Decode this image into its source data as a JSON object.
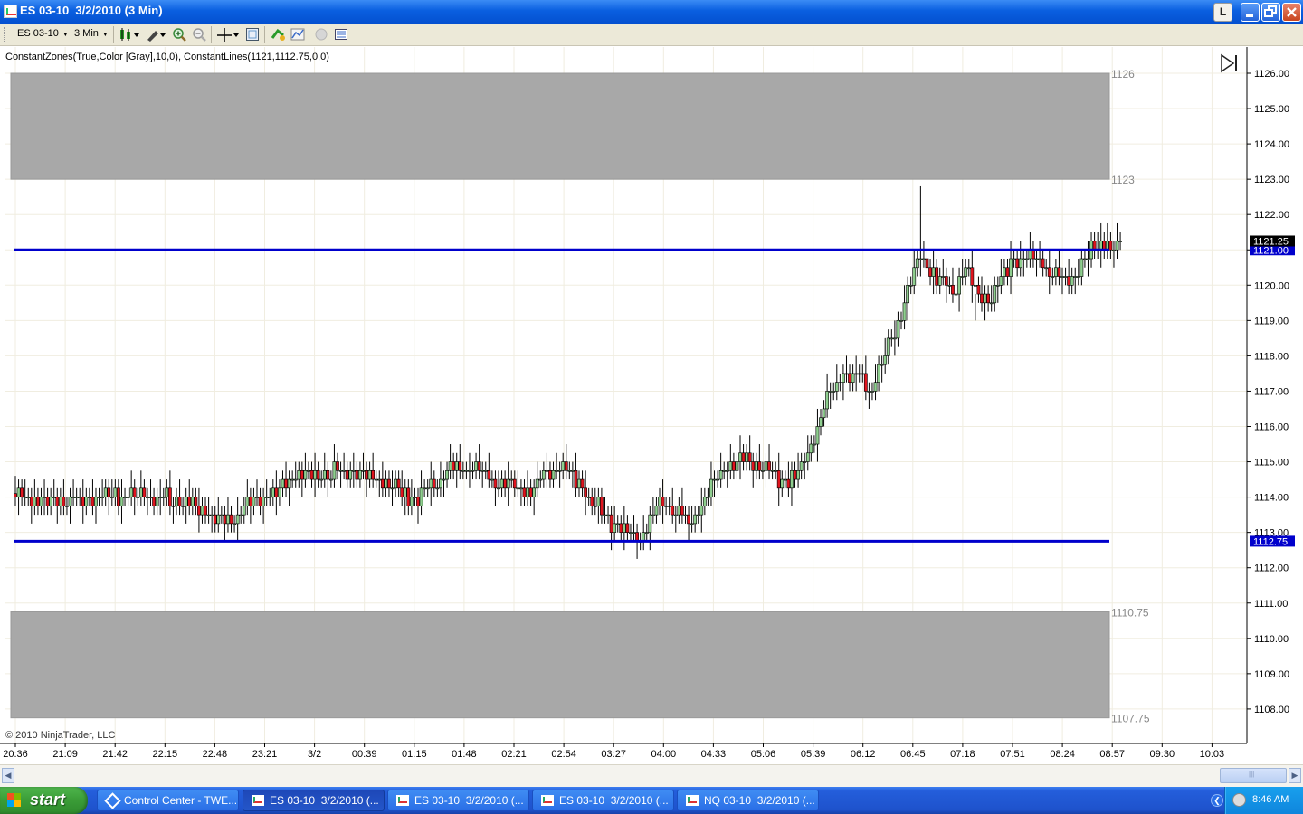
{
  "window": {
    "title": "ES 03-10  3/2/2010 (3 Min)",
    "buttons": {
      "link": "L",
      "minimize": "▁",
      "restore": "❐",
      "close": "✕"
    }
  },
  "toolbar": {
    "instrument": "ES 03-10",
    "interval": "3 Min"
  },
  "indicator_label": "ConstantZones(True,Color [Gray],10,0), ConstantLines(1121,1112.75,0,0)",
  "copyright": "© 2010 NinjaTrader, LLC",
  "colors": {
    "up_bar": "#8fcf8f",
    "down_bar": "#e0141e",
    "zone": "#a8a8a8",
    "line": "#0000cc",
    "grid": "#f0ede0"
  },
  "chart_data": {
    "type": "candlestick",
    "title": "",
    "ylim": [
      1107.4,
      1126.5
    ],
    "y_ticks": [
      "1126.00",
      "1125.00",
      "1124.00",
      "1123.00",
      "1122.00",
      "1121.00",
      "1120.00",
      "1119.00",
      "1118.00",
      "1117.00",
      "1116.00",
      "1115.00",
      "1114.00",
      "1113.00",
      "1112.00",
      "1111.00",
      "1110.00",
      "1109.00",
      "1108.00"
    ],
    "x_ticks": [
      "20:36",
      "21:09",
      "21:42",
      "22:15",
      "22:48",
      "23:21",
      "3/2",
      "00:39",
      "01:15",
      "01:48",
      "02:21",
      "02:54",
      "03:27",
      "04:00",
      "04:33",
      "05:06",
      "05:39",
      "06:12",
      "06:45",
      "07:18",
      "07:51",
      "08:24",
      "08:57",
      "09:30",
      "10:03"
    ],
    "zones": [
      {
        "top": 1126,
        "bottom": 1123,
        "top_label": "1126",
        "bottom_label": "1123"
      },
      {
        "top": 1110.75,
        "bottom": 1107.75,
        "top_label": "1110.75",
        "bottom_label": "1107.75"
      }
    ],
    "lines": [
      {
        "value": 1121,
        "label": "1121.00"
      },
      {
        "value": 1112.75,
        "label": "1112.75"
      }
    ],
    "last_price": {
      "value": 1121.25,
      "label": "1121.25"
    },
    "anchors": [
      [
        0,
        1114
      ],
      [
        10,
        1113.9
      ],
      [
        20,
        1113.9
      ],
      [
        30,
        1114.1
      ],
      [
        40,
        1114.05
      ],
      [
        50,
        1113.9
      ],
      [
        60,
        1113.5
      ],
      [
        67,
        1113.4
      ],
      [
        75,
        1113.9
      ],
      [
        82,
        1114.2
      ],
      [
        88,
        1114.65
      ],
      [
        95,
        1114.6
      ],
      [
        100,
        1114.7
      ],
      [
        110,
        1114.6
      ],
      [
        120,
        1114.1
      ],
      [
        125,
        1113.95
      ],
      [
        130,
        1114.4
      ],
      [
        135,
        1114.75
      ],
      [
        140,
        1114.8
      ],
      [
        146,
        1114.7
      ],
      [
        150,
        1114.35
      ],
      [
        155,
        1114.3
      ],
      [
        160,
        1114.1
      ],
      [
        165,
        1114.7
      ],
      [
        170,
        1114.9
      ],
      [
        175,
        1114.4
      ],
      [
        178,
        1113.9
      ],
      [
        182,
        1113.6
      ],
      [
        185,
        1113.3
      ],
      [
        190,
        1113.05
      ],
      [
        193,
        1112.85
      ],
      [
        196,
        1113.1
      ],
      [
        200,
        1113.9
      ],
      [
        203,
        1113.7
      ],
      [
        206,
        1113.5
      ],
      [
        210,
        1113.3
      ],
      [
        214,
        1113.9
      ],
      [
        218,
        1114.6
      ],
      [
        222,
        1114.9
      ],
      [
        228,
        1115.05
      ],
      [
        233,
        1114.8
      ],
      [
        238,
        1114.45
      ],
      [
        243,
        1114.6
      ],
      [
        247,
        1115.4
      ],
      [
        252,
        1116.8
      ],
      [
        257,
        1117.5
      ],
      [
        262,
        1117.4
      ],
      [
        266,
        1117.1
      ],
      [
        270,
        1118
      ],
      [
        274,
        1118.9
      ],
      [
        278,
        1120.15
      ],
      [
        281,
        1120.8
      ],
      [
        283,
        1120.6
      ],
      [
        287,
        1120.1
      ],
      [
        291,
        1119.85
      ],
      [
        295,
        1120.5
      ],
      [
        299,
        1119.6
      ],
      [
        303,
        1119.65
      ],
      [
        306,
        1120.15
      ],
      [
        310,
        1120.75
      ],
      [
        314,
        1120.8
      ],
      [
        318,
        1120.75
      ],
      [
        322,
        1120.3
      ],
      [
        326,
        1120.05
      ],
      [
        330,
        1120.35
      ],
      [
        334,
        1121.05
      ],
      [
        338,
        1121.25
      ],
      [
        341,
        1120.95
      ],
      [
        343,
        1121.25
      ]
    ],
    "special_highs": {
      "281": 1122.8,
      "298": 1119.0,
      "337": 1121.75
    }
  },
  "taskbar": {
    "start_label": "start",
    "tasks": [
      {
        "label": "Control Center - TWE..."
      },
      {
        "label": "ES 03-10  3/2/2010 (..."
      },
      {
        "label": "ES 03-10  3/2/2010 (..."
      },
      {
        "label": "ES 03-10  3/2/2010 (..."
      },
      {
        "label": "NQ 03-10  3/2/2010 (..."
      }
    ],
    "clock": "8:46 AM"
  }
}
